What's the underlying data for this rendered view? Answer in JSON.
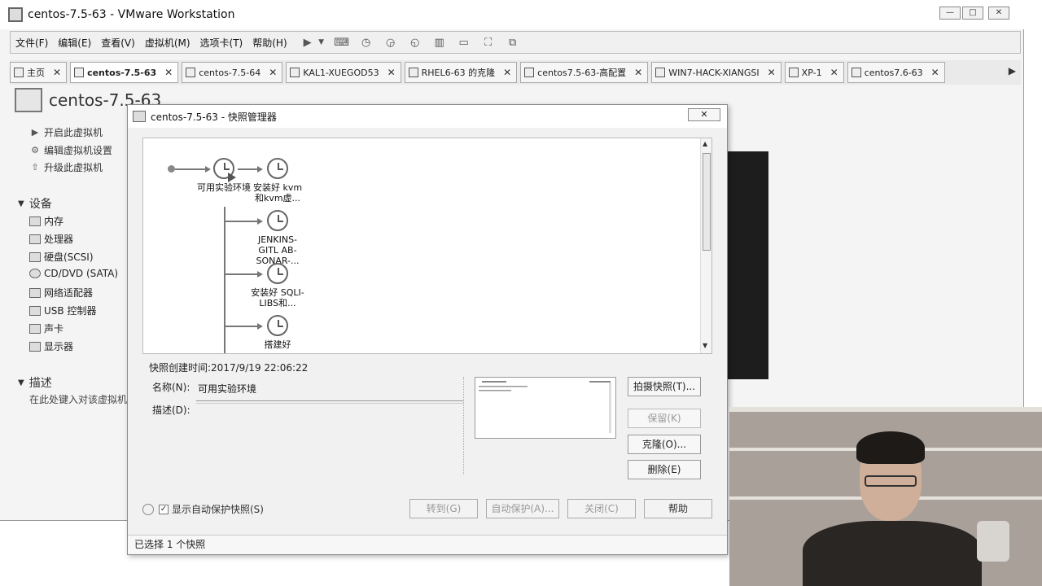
{
  "window": {
    "title": "centos-7.5-63 - VMware Workstation",
    "controls": [
      "—",
      "□",
      "✕"
    ]
  },
  "menubar": {
    "items": [
      "文件(F)",
      "编辑(E)",
      "查看(V)",
      "虚拟机(M)",
      "选项卡(T)",
      "帮助(H)"
    ]
  },
  "tabs": [
    {
      "label": "主页",
      "icon": "home-icon",
      "active": false
    },
    {
      "label": "centos-7.5-63",
      "icon": "vm-icon",
      "active": true
    },
    {
      "label": "centos-7.5-64",
      "icon": "vm-icon",
      "active": false
    },
    {
      "label": "KAL1-XUEGOD53",
      "icon": "vm-icon",
      "active": false
    },
    {
      "label": "RHEL6-63 的克隆",
      "icon": "vm-icon",
      "active": false
    },
    {
      "label": "centos7.5-63-高配置",
      "icon": "vm-icon",
      "active": false
    },
    {
      "label": "WIN7-HACK-XIANGSI",
      "icon": "vm-icon",
      "active": false
    },
    {
      "label": "XP-1",
      "icon": "vm-icon",
      "active": false
    },
    {
      "label": "centos7.6-63",
      "icon": "vm-icon",
      "active": false
    }
  ],
  "left_pane": {
    "vm_name": "centos-7.5-63",
    "actions": [
      "开启此虚拟机",
      "编辑虚拟机设置",
      "升级此虚拟机"
    ],
    "devices_header": "设备",
    "devices": [
      "内存",
      "处理器",
      "硬盘(SCSI)",
      "CD/DVD (SATA)",
      "网络适配器",
      "USB 控制器",
      "声卡",
      "显示器"
    ],
    "description_header": "描述",
    "description_hint": "在此处键入对该虚拟机"
  },
  "dialog": {
    "title": "centos-7.5-63 - 快照管理器",
    "close_label": "✕",
    "snapshots": [
      {
        "label": "可用实验环境"
      },
      {
        "label": "安装好 kvm 和kvm虚..."
      },
      {
        "label": "JENKINS-GITL AB-SONAR-..."
      },
      {
        "label": "安装好 SQLI-LIBS和..."
      },
      {
        "label": "搭建好"
      }
    ],
    "created_label": "快照创建时间:",
    "created_value": "2017/9/19 22:06:22",
    "name_label": "名称(N):",
    "name_value": "可用实验环境",
    "desc_label": "描述(D):",
    "desc_value": "",
    "side_buttons": [
      {
        "label": "拍摄快照(T)...",
        "enabled": true
      },
      {
        "label": "保留(K)",
        "enabled": false
      },
      {
        "label": "克隆(O)...",
        "enabled": true
      },
      {
        "label": "删除(E)",
        "enabled": true
      }
    ],
    "auto_protect_label": "显示自动保护快照(S)",
    "auto_protect_checked": true,
    "bottom_buttons": [
      {
        "label": "转到(G)",
        "enabled": false
      },
      {
        "label": "自动保护(A)...",
        "enabled": false
      },
      {
        "label": "关闭(C)",
        "enabled": false
      },
      {
        "label": "帮助",
        "enabled": true
      }
    ],
    "status": "已选择 1 个快照"
  }
}
